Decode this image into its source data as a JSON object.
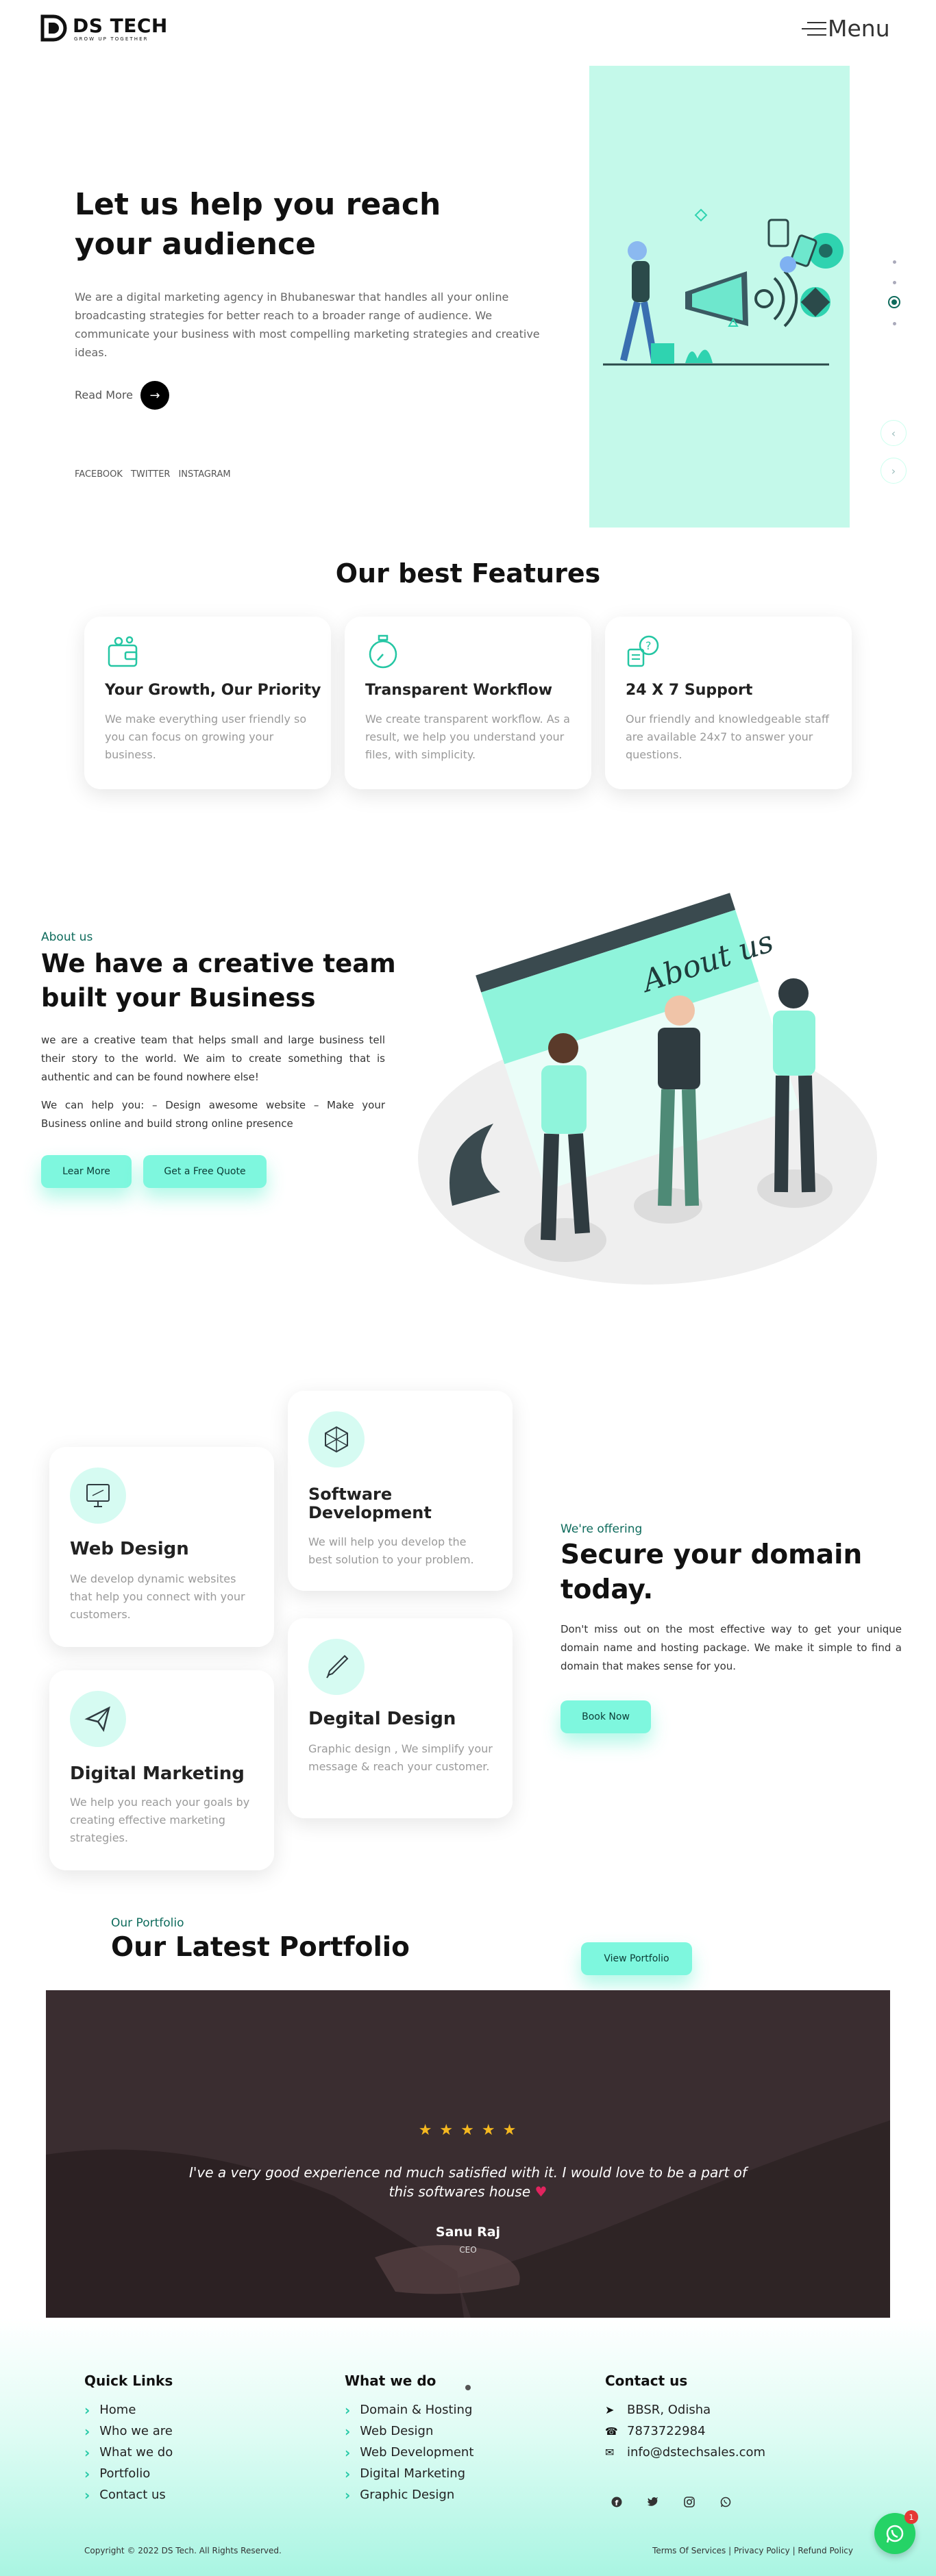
{
  "header": {
    "logo_text": "DS TECH",
    "logo_tagline": "GROW UP TOGETHER",
    "menu_label": "Menu"
  },
  "hero": {
    "title": "Let us help you reach your audience",
    "description": "We are a digital marketing agency in Bhubaneswar that handles all your online broadcasting strategies for better reach to a broader range of audience. We communicate your business with most compelling marketing strategies and creative ideas.",
    "read_more": "Read More",
    "social": [
      "FACEBOOK",
      "TWITTER",
      "INSTAGRAM"
    ]
  },
  "features": {
    "heading": "Our best Features",
    "items": [
      {
        "title": "Your Growth, Our Priority",
        "text": "We make everything user friendly so you can focus on growing your business.",
        "icon": "wallet-icon"
      },
      {
        "title": "Transparent Workflow",
        "text": "We create transparent workflow. As a result, we help you understand your files, with simplicity.",
        "icon": "stopwatch-icon"
      },
      {
        "title": "24 X 7 Support",
        "text": "Our friendly and knowledgeable staff are available 24x7 to answer your questions.",
        "icon": "support-chat-icon"
      }
    ]
  },
  "about": {
    "eyebrow": "About us",
    "title": "We have a creative team built your Business",
    "p1": " we are a creative team that helps small and large business tell their story to the world. We aim to create something that is authentic and can be found nowhere else!",
    "p2": "We can help you: – Design awesome website – Make your Business online and build strong online presence",
    "btn1": "Lear More",
    "btn2": "Get a Free Quote",
    "illustration_text": "About us"
  },
  "services": {
    "items": [
      {
        "title": "Software Development",
        "text": "We will help you develop the best solution to your problem.",
        "icon": "hexagon-cube-icon"
      },
      {
        "title": "Web Design",
        "text": "We develop dynamic websites that help you connect with your customers.",
        "icon": "monitor-design-icon"
      },
      {
        "title": "Degital Design",
        "text": "Graphic design , We simplify your message & reach your customer.",
        "icon": "pen-brush-icon"
      },
      {
        "title": "Digital Marketing",
        "text": "We help you reach your goals by creating effective marketing strategies.",
        "icon": "paper-plane-icon"
      }
    ],
    "eyebrow": "We're offering",
    "title": "Secure your domain today.",
    "text": "Don't miss out on the most effective way to get your unique domain name and hosting package. We make it simple to find a domain that makes sense for you.",
    "button": "Book Now"
  },
  "portfolio": {
    "eyebrow": "Our Portfolio",
    "title": "Our Latest Portfolio",
    "button": "View Portfolio"
  },
  "testimonial": {
    "stars": "★ ★ ★ ★ ★",
    "quote": "I've a very good experience nd much satisfied with it. I would love to be a part of this softwares house",
    "heart": "♥",
    "name": "Sanu Raj",
    "role": "CEO"
  },
  "footer": {
    "quick_links_title": "Quick Links",
    "quick_links": [
      "Home",
      "Who we are",
      "What we do",
      "Portfolio",
      "Contact us"
    ],
    "what_we_do_title": "What we do",
    "what_we_do": [
      "Domain & Hosting",
      "Web Design",
      "Web Development",
      "Digital Marketing",
      "Graphic Design"
    ],
    "contact_title": "Contact us",
    "contact": {
      "address": "BBSR, Odisha",
      "phone": "7873722984",
      "email": "info@dstechsales.com"
    },
    "copyright": "Copyright © 2022 DS Tech. All Rights Reserved.",
    "legal": "Terms Of Services | Privacy Policy | Refund Policy",
    "whatsapp_badge": "1"
  },
  "colors": {
    "accent": "#7ef7de",
    "accent_dark": "#27c9a8",
    "hero_panel": "#c4f9ea",
    "eyebrow": "#0e6b5c"
  }
}
